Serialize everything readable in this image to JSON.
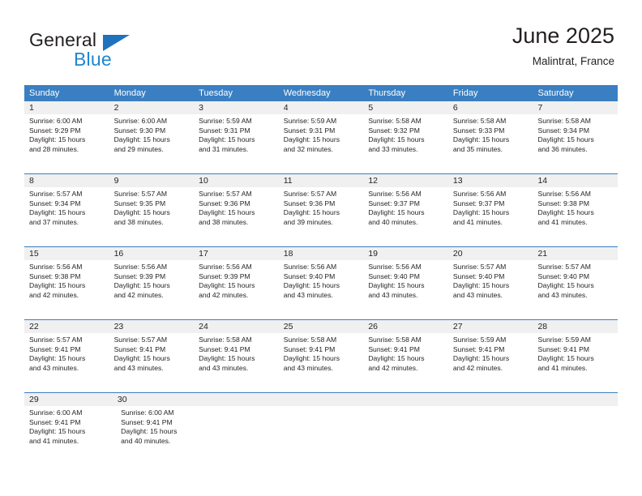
{
  "brand": {
    "word_one": "General",
    "word_two": "Blue",
    "flag_icon": "triangle-flag-icon",
    "accent_color": "#1f72bd",
    "blue_text_color": "#1f86d0"
  },
  "header": {
    "title": "June 2025",
    "subtitle": "Malintrat, France"
  },
  "calendar": {
    "header_bg": "#3a7fc1",
    "header_text_color": "#ffffff",
    "daynum_bg": "#f0f0f0",
    "weekdays": [
      "Sunday",
      "Monday",
      "Tuesday",
      "Wednesday",
      "Thursday",
      "Friday",
      "Saturday"
    ],
    "weeks": [
      {
        "days": [
          {
            "num": "1",
            "sunrise": "Sunrise: 6:00 AM",
            "sunset": "Sunset: 9:29 PM",
            "daylight_line1": "Daylight: 15 hours",
            "daylight_line2": "and 28 minutes."
          },
          {
            "num": "2",
            "sunrise": "Sunrise: 6:00 AM",
            "sunset": "Sunset: 9:30 PM",
            "daylight_line1": "Daylight: 15 hours",
            "daylight_line2": "and 29 minutes."
          },
          {
            "num": "3",
            "sunrise": "Sunrise: 5:59 AM",
            "sunset": "Sunset: 9:31 PM",
            "daylight_line1": "Daylight: 15 hours",
            "daylight_line2": "and 31 minutes."
          },
          {
            "num": "4",
            "sunrise": "Sunrise: 5:59 AM",
            "sunset": "Sunset: 9:31 PM",
            "daylight_line1": "Daylight: 15 hours",
            "daylight_line2": "and 32 minutes."
          },
          {
            "num": "5",
            "sunrise": "Sunrise: 5:58 AM",
            "sunset": "Sunset: 9:32 PM",
            "daylight_line1": "Daylight: 15 hours",
            "daylight_line2": "and 33 minutes."
          },
          {
            "num": "6",
            "sunrise": "Sunrise: 5:58 AM",
            "sunset": "Sunset: 9:33 PM",
            "daylight_line1": "Daylight: 15 hours",
            "daylight_line2": "and 35 minutes."
          },
          {
            "num": "7",
            "sunrise": "Sunrise: 5:58 AM",
            "sunset": "Sunset: 9:34 PM",
            "daylight_line1": "Daylight: 15 hours",
            "daylight_line2": "and 36 minutes."
          }
        ]
      },
      {
        "days": [
          {
            "num": "8",
            "sunrise": "Sunrise: 5:57 AM",
            "sunset": "Sunset: 9:34 PM",
            "daylight_line1": "Daylight: 15 hours",
            "daylight_line2": "and 37 minutes."
          },
          {
            "num": "9",
            "sunrise": "Sunrise: 5:57 AM",
            "sunset": "Sunset: 9:35 PM",
            "daylight_line1": "Daylight: 15 hours",
            "daylight_line2": "and 38 minutes."
          },
          {
            "num": "10",
            "sunrise": "Sunrise: 5:57 AM",
            "sunset": "Sunset: 9:36 PM",
            "daylight_line1": "Daylight: 15 hours",
            "daylight_line2": "and 38 minutes."
          },
          {
            "num": "11",
            "sunrise": "Sunrise: 5:57 AM",
            "sunset": "Sunset: 9:36 PM",
            "daylight_line1": "Daylight: 15 hours",
            "daylight_line2": "and 39 minutes."
          },
          {
            "num": "12",
            "sunrise": "Sunrise: 5:56 AM",
            "sunset": "Sunset: 9:37 PM",
            "daylight_line1": "Daylight: 15 hours",
            "daylight_line2": "and 40 minutes."
          },
          {
            "num": "13",
            "sunrise": "Sunrise: 5:56 AM",
            "sunset": "Sunset: 9:37 PM",
            "daylight_line1": "Daylight: 15 hours",
            "daylight_line2": "and 41 minutes."
          },
          {
            "num": "14",
            "sunrise": "Sunrise: 5:56 AM",
            "sunset": "Sunset: 9:38 PM",
            "daylight_line1": "Daylight: 15 hours",
            "daylight_line2": "and 41 minutes."
          }
        ]
      },
      {
        "days": [
          {
            "num": "15",
            "sunrise": "Sunrise: 5:56 AM",
            "sunset": "Sunset: 9:38 PM",
            "daylight_line1": "Daylight: 15 hours",
            "daylight_line2": "and 42 minutes."
          },
          {
            "num": "16",
            "sunrise": "Sunrise: 5:56 AM",
            "sunset": "Sunset: 9:39 PM",
            "daylight_line1": "Daylight: 15 hours",
            "daylight_line2": "and 42 minutes."
          },
          {
            "num": "17",
            "sunrise": "Sunrise: 5:56 AM",
            "sunset": "Sunset: 9:39 PM",
            "daylight_line1": "Daylight: 15 hours",
            "daylight_line2": "and 42 minutes."
          },
          {
            "num": "18",
            "sunrise": "Sunrise: 5:56 AM",
            "sunset": "Sunset: 9:40 PM",
            "daylight_line1": "Daylight: 15 hours",
            "daylight_line2": "and 43 minutes."
          },
          {
            "num": "19",
            "sunrise": "Sunrise: 5:56 AM",
            "sunset": "Sunset: 9:40 PM",
            "daylight_line1": "Daylight: 15 hours",
            "daylight_line2": "and 43 minutes."
          },
          {
            "num": "20",
            "sunrise": "Sunrise: 5:57 AM",
            "sunset": "Sunset: 9:40 PM",
            "daylight_line1": "Daylight: 15 hours",
            "daylight_line2": "and 43 minutes."
          },
          {
            "num": "21",
            "sunrise": "Sunrise: 5:57 AM",
            "sunset": "Sunset: 9:40 PM",
            "daylight_line1": "Daylight: 15 hours",
            "daylight_line2": "and 43 minutes."
          }
        ]
      },
      {
        "days": [
          {
            "num": "22",
            "sunrise": "Sunrise: 5:57 AM",
            "sunset": "Sunset: 9:41 PM",
            "daylight_line1": "Daylight: 15 hours",
            "daylight_line2": "and 43 minutes."
          },
          {
            "num": "23",
            "sunrise": "Sunrise: 5:57 AM",
            "sunset": "Sunset: 9:41 PM",
            "daylight_line1": "Daylight: 15 hours",
            "daylight_line2": "and 43 minutes."
          },
          {
            "num": "24",
            "sunrise": "Sunrise: 5:58 AM",
            "sunset": "Sunset: 9:41 PM",
            "daylight_line1": "Daylight: 15 hours",
            "daylight_line2": "and 43 minutes."
          },
          {
            "num": "25",
            "sunrise": "Sunrise: 5:58 AM",
            "sunset": "Sunset: 9:41 PM",
            "daylight_line1": "Daylight: 15 hours",
            "daylight_line2": "and 43 minutes."
          },
          {
            "num": "26",
            "sunrise": "Sunrise: 5:58 AM",
            "sunset": "Sunset: 9:41 PM",
            "daylight_line1": "Daylight: 15 hours",
            "daylight_line2": "and 42 minutes."
          },
          {
            "num": "27",
            "sunrise": "Sunrise: 5:59 AM",
            "sunset": "Sunset: 9:41 PM",
            "daylight_line1": "Daylight: 15 hours",
            "daylight_line2": "and 42 minutes."
          },
          {
            "num": "28",
            "sunrise": "Sunrise: 5:59 AM",
            "sunset": "Sunset: 9:41 PM",
            "daylight_line1": "Daylight: 15 hours",
            "daylight_line2": "and 41 minutes."
          }
        ]
      },
      {
        "days": [
          {
            "num": "29",
            "sunrise": "Sunrise: 6:00 AM",
            "sunset": "Sunset: 9:41 PM",
            "daylight_line1": "Daylight: 15 hours",
            "daylight_line2": "and 41 minutes."
          },
          {
            "num": "30",
            "sunrise": "Sunrise: 6:00 AM",
            "sunset": "Sunset: 9:41 PM",
            "daylight_line1": "Daylight: 15 hours",
            "daylight_line2": "and 40 minutes."
          }
        ]
      }
    ]
  }
}
